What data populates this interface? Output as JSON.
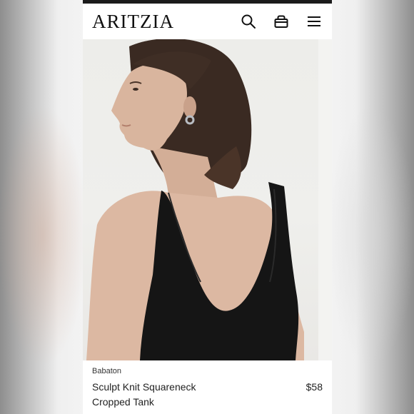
{
  "header": {
    "logo": "ARITZIA",
    "icons": [
      "search-icon",
      "bag-icon",
      "menu-icon"
    ]
  },
  "product": {
    "brand": "Babaton",
    "name": "Sculpt Knit Squareneck Cropped Tank",
    "price": "$58",
    "image_alt": "Model wearing black knit squareneck tank, back view"
  },
  "colors": {
    "tank": "#151515",
    "skin": "#d9b59e",
    "hair": "#3a2a22",
    "background": "#ededea"
  }
}
